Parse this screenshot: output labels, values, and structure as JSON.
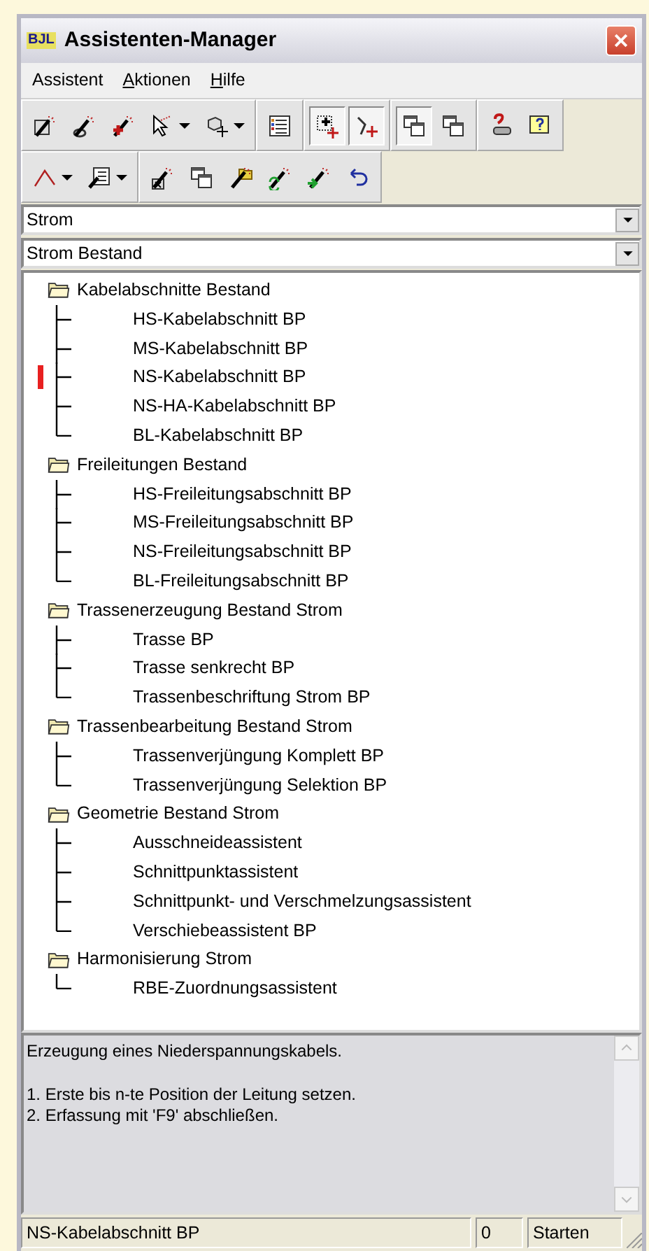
{
  "window": {
    "title": "Assistenten-Manager",
    "logo": "BJL"
  },
  "menu": [
    {
      "label": "Assistent",
      "underlined_first": false
    },
    {
      "label": "Aktionen",
      "underlined_first": true
    },
    {
      "label": "Hilfe",
      "underlined_first": true
    }
  ],
  "toolbars": [
    [
      {
        "kind": "wand-check",
        "pressed": false,
        "dropdown": false
      },
      {
        "kind": "wand-link",
        "pressed": false,
        "dropdown": false
      },
      {
        "kind": "wand-plus",
        "pressed": false,
        "dropdown": false
      },
      {
        "kind": "cursor-wand",
        "pressed": false,
        "dropdown": true
      },
      {
        "kind": "cube-move",
        "pressed": false,
        "dropdown": true
      },
      {
        "kind": "list",
        "pressed": false,
        "dropdown": false,
        "group_start": true
      },
      {
        "kind": "select-move",
        "pressed": true,
        "dropdown": false,
        "group_start": true
      },
      {
        "kind": "vertex-move",
        "pressed": true,
        "dropdown": false
      },
      {
        "kind": "windows",
        "pressed": true,
        "dropdown": false,
        "group_start": true
      },
      {
        "kind": "windows",
        "pressed": false,
        "dropdown": false
      },
      {
        "kind": "help-key",
        "pressed": false,
        "dropdown": false,
        "group_start": true
      },
      {
        "kind": "help-bubble",
        "pressed": false,
        "dropdown": false
      }
    ],
    [
      {
        "kind": "polyline",
        "pressed": false,
        "dropdown": true
      },
      {
        "kind": "form-wand",
        "pressed": false,
        "dropdown": true
      },
      {
        "kind": "wand-delete",
        "pressed": false,
        "dropdown": false,
        "group_start": true
      },
      {
        "kind": "windows",
        "pressed": false,
        "dropdown": false
      },
      {
        "kind": "wand-folder",
        "pressed": false,
        "dropdown": false
      },
      {
        "kind": "wand-refresh",
        "pressed": false,
        "dropdown": false
      },
      {
        "kind": "wand-arrow",
        "pressed": false,
        "dropdown": false
      },
      {
        "kind": "undo",
        "pressed": false,
        "dropdown": false
      }
    ]
  ],
  "selects": [
    {
      "value": "Strom"
    },
    {
      "value": "Strom Bestand"
    }
  ],
  "tree": [
    {
      "label": "Kabelabschnitte Bestand",
      "children": [
        {
          "label": "HS-Kabelabschnitt BP",
          "marked": false
        },
        {
          "label": "MS-Kabelabschnitt BP",
          "marked": false
        },
        {
          "label": "NS-Kabelabschnitt BP",
          "marked": true
        },
        {
          "label": "NS-HA-Kabelabschnitt BP",
          "marked": false
        },
        {
          "label": "BL-Kabelabschnitt BP",
          "marked": false
        }
      ]
    },
    {
      "label": "Freileitungen Bestand",
      "children": [
        {
          "label": "HS-Freileitungsabschnitt BP",
          "marked": false
        },
        {
          "label": "MS-Freileitungsabschnitt BP",
          "marked": false
        },
        {
          "label": "NS-Freileitungsabschnitt BP",
          "marked": false
        },
        {
          "label": "BL-Freileitungsabschnitt BP",
          "marked": false
        }
      ]
    },
    {
      "label": "Trassenerzeugung Bestand Strom",
      "children": [
        {
          "label": "Trasse BP",
          "marked": false
        },
        {
          "label": "Trasse senkrecht BP",
          "marked": false
        },
        {
          "label": "Trassenbeschriftung Strom BP",
          "marked": false
        }
      ]
    },
    {
      "label": "Trassenbearbeitung Bestand Strom",
      "children": [
        {
          "label": "Trassenverjüngung Komplett BP",
          "marked": false
        },
        {
          "label": "Trassenverjüngung Selektion BP",
          "marked": false
        }
      ]
    },
    {
      "label": "Geometrie Bestand Strom",
      "children": [
        {
          "label": "Ausschneideassistent",
          "marked": false
        },
        {
          "label": "Schnittpunktassistent",
          "marked": false
        },
        {
          "label": "Schnittpunkt- und Verschmelzungsassistent",
          "marked": false
        },
        {
          "label": "Verschiebeassistent BP",
          "marked": false
        }
      ]
    },
    {
      "label": "Harmonisierung Strom",
      "children": [
        {
          "label": "RBE-Zuordnungsassistent",
          "marked": false
        }
      ]
    }
  ],
  "description": {
    "summary": "Erzeugung eines Niederspannungskabels.",
    "steps": [
      "1. Erste bis n-te Position der Leitung setzen.",
      "2. Erfassung mit 'F9' abschließen."
    ]
  },
  "status_bar": {
    "item": "NS-Kabelabschnitt BP",
    "count": "0",
    "action": "Starten"
  }
}
